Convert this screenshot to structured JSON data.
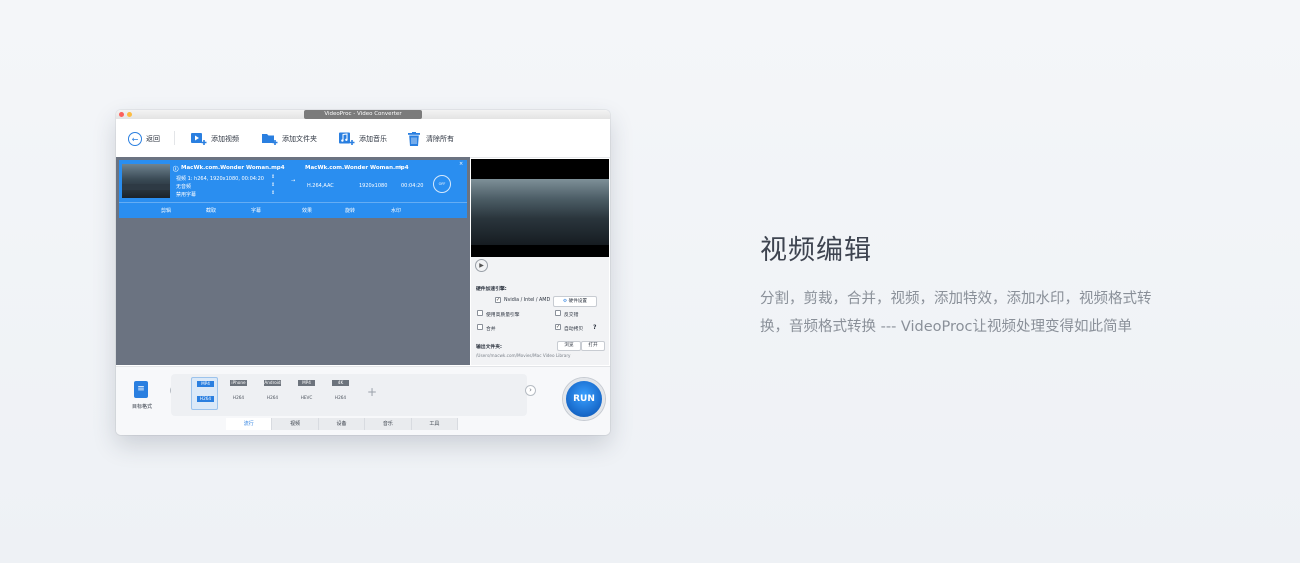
{
  "promo": {
    "title": "视频编辑",
    "description": "分割，剪裁，合并，视频，添加特效，添加水印，视频格式转换，音频格式转换 --- VideoProc让视频处理变得如此简单"
  },
  "window": {
    "title": "VideoProc - Video Converter",
    "traffic_light_colors": [
      "#fc605c",
      "#fdbc40"
    ]
  },
  "toolbar": {
    "back": "返回",
    "add_video": "添加视频",
    "add_folder": "添加文件夹",
    "add_music": "添加音乐",
    "clear_all": "清除所有"
  },
  "item": {
    "source_name": "MacWk.com.Wonder Woman.mp4",
    "output_name": "MacWk.com.Wonder Woman.mp4",
    "video_track": "视频 1: h264, 1920x1080, 00:04:20",
    "audio": "无音频",
    "subtitle": "禁用字幕",
    "codec_out": "H.264,AAC",
    "resolution_out": "1920x1080",
    "duration_out": "00:04:20",
    "codec_badge": "OFF",
    "controls": [
      "剪辑",
      "截取",
      "字幕",
      "效果",
      "旋转",
      "水印"
    ]
  },
  "options": {
    "hw_accel_title": "硬件加速引擎:",
    "nvidia_intel_amd": "Nvidia / Intel / AMD",
    "hw_settings": "硬件设置",
    "high_quality": "使用高质量引擎",
    "deinterlace": "反交错",
    "merge": "合并",
    "auto_copy": "自动拷贝",
    "help": "?",
    "output_folder_label": "输出文件夹:",
    "browse": "浏览",
    "open": "打开",
    "output_path": "/Users/macwk.com/Movies/Mac Video Library"
  },
  "target_format": {
    "label": "目标格式"
  },
  "formats": [
    {
      "top": "MP4",
      "bottom": "H264",
      "selected": true
    },
    {
      "top": "iPhone",
      "bottom": "H264",
      "selected": false
    },
    {
      "top": "Android",
      "bottom": "H264",
      "selected": false
    },
    {
      "top": "MP4",
      "bottom": "HEVC",
      "selected": false
    },
    {
      "top": "4K",
      "bottom": "H264",
      "selected": false
    }
  ],
  "run_button": "RUN",
  "tabs": [
    {
      "label": "流行",
      "active": true
    },
    {
      "label": "视频",
      "active": false
    },
    {
      "label": "设备",
      "active": false
    },
    {
      "label": "音乐",
      "active": false
    },
    {
      "label": "工具",
      "active": false
    }
  ],
  "colors": {
    "accent": "#2a8ef0",
    "list_background": "#6b7381"
  }
}
